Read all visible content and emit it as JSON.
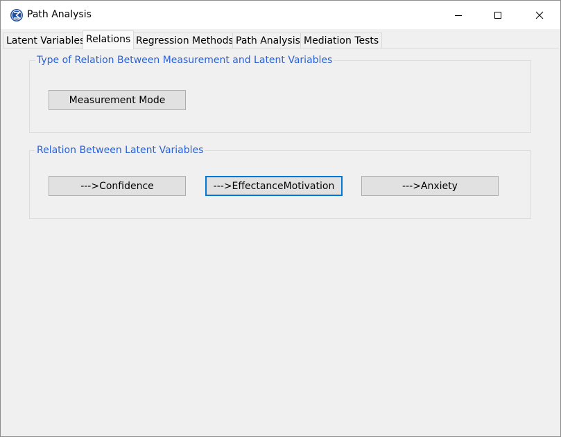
{
  "window": {
    "title": "Path Analysis",
    "icon": "sigma-globe-icon"
  },
  "controls": {
    "minimize": "minimize-icon",
    "maximize": "maximize-icon",
    "close": "close-icon"
  },
  "tabs": [
    {
      "label": "Latent Variables",
      "active": false
    },
    {
      "label": "Relations",
      "active": true
    },
    {
      "label": "Regression Methods",
      "active": false
    },
    {
      "label": "Path Analysis",
      "active": false
    },
    {
      "label": "Mediation Tests",
      "active": false
    }
  ],
  "measurement_group": {
    "title": "Type of Relation Between Measurement and Latent Variables",
    "button_label": "Measurement Mode"
  },
  "latent_group": {
    "title": "Relation Between Latent Variables",
    "buttons": [
      {
        "label": "--->Confidence"
      },
      {
        "label": "--->EffectanceMotivation"
      },
      {
        "label": "--->Anxiety"
      }
    ]
  },
  "colors": {
    "group_title": "#2a5fd6",
    "focus_border": "#0078d7"
  }
}
